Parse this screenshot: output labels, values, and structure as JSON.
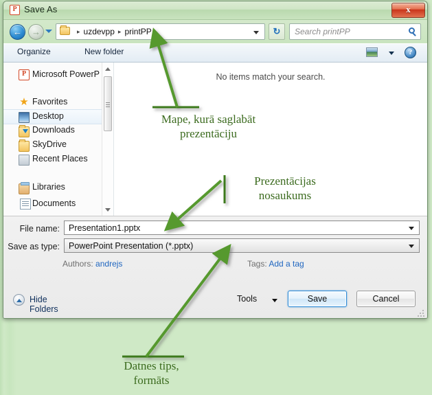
{
  "window": {
    "title": "Save As",
    "app_icon": "powerpoint-icon",
    "close_label": "x"
  },
  "navbar": {
    "back_icon": "back-arrow-icon",
    "forward_icon": "forward-arrow-icon",
    "recent_dropdown_icon": "chevron-down-icon",
    "folder_icon": "folder-icon",
    "breadcrumbs": [
      "uzdevpp",
      "printPP"
    ],
    "breadcrumb_separator": "▸",
    "breadcrumb_dropdown_icon": "chevron-down-icon",
    "refresh_icon": "refresh-icon",
    "refresh_glyph": "↻",
    "search_placeholder": "Search printPP",
    "search_value": "",
    "search_icon": "search-icon"
  },
  "toolbar": {
    "organize_label": "Organize",
    "organize_caret_icon": "chevron-down-icon",
    "new_folder_label": "New folder",
    "view_icon": "view-layout-icon",
    "view_caret_icon": "chevron-down-icon",
    "help_icon": "help-icon",
    "help_glyph": "?"
  },
  "sidebar": {
    "items": [
      {
        "label": "Microsoft PowerP",
        "icon": "powerpoint-icon",
        "type": "app",
        "selected": false
      },
      {
        "label": "Favorites",
        "icon": "star-icon",
        "type": "header",
        "selected": false
      },
      {
        "label": "Desktop",
        "icon": "desktop-icon",
        "type": "item",
        "selected": true
      },
      {
        "label": "Downloads",
        "icon": "downloads-folder-icon",
        "type": "item",
        "selected": false
      },
      {
        "label": "SkyDrive",
        "icon": "folder-icon",
        "type": "item",
        "selected": false
      },
      {
        "label": "Recent Places",
        "icon": "recent-places-icon",
        "type": "item",
        "selected": false
      },
      {
        "label": "Libraries",
        "icon": "libraries-icon",
        "type": "header",
        "selected": false
      },
      {
        "label": "Documents",
        "icon": "document-icon",
        "type": "item",
        "selected": false
      }
    ],
    "scroll_up_icon": "scroll-up-arrow-icon",
    "scroll_down_icon": "scroll-down-arrow-icon"
  },
  "filelist": {
    "empty_message": "No items match your search."
  },
  "form": {
    "file_name_label": "File name:",
    "file_name_value": "Presentation1.pptx",
    "save_as_type_label": "Save as type:",
    "save_as_type_value": "PowerPoint Presentation (*.pptx)",
    "authors_label": "Authors:",
    "authors_value": "andrejs",
    "tags_label": "Tags:",
    "tags_value": "Add a tag",
    "dropdown_icon": "chevron-down-icon"
  },
  "footer": {
    "hide_folders_label": "Hide Folders",
    "hide_folders_icon": "chevron-up-circle-icon",
    "tools_label": "Tools",
    "tools_caret_icon": "chevron-down-icon",
    "save_label": "Save",
    "cancel_label": "Cancel",
    "resize_grip_icon": "resize-grip-icon"
  },
  "annotations": [
    {
      "id": "folder-callout",
      "text": "Mape, kurā saglabāt\nprezentāciju"
    },
    {
      "id": "filename-callout",
      "text": "Prezentācijas\nnosaukums"
    },
    {
      "id": "filetype-callout",
      "text": "Datnes tips,\nformāts"
    }
  ],
  "colors": {
    "annotation_green": "#3c6b1f",
    "arrow_green": "#56992e",
    "desktop_green": "#c9e7c0",
    "accent_blue": "#1f66c0",
    "powerpoint_orange": "#d24726"
  }
}
